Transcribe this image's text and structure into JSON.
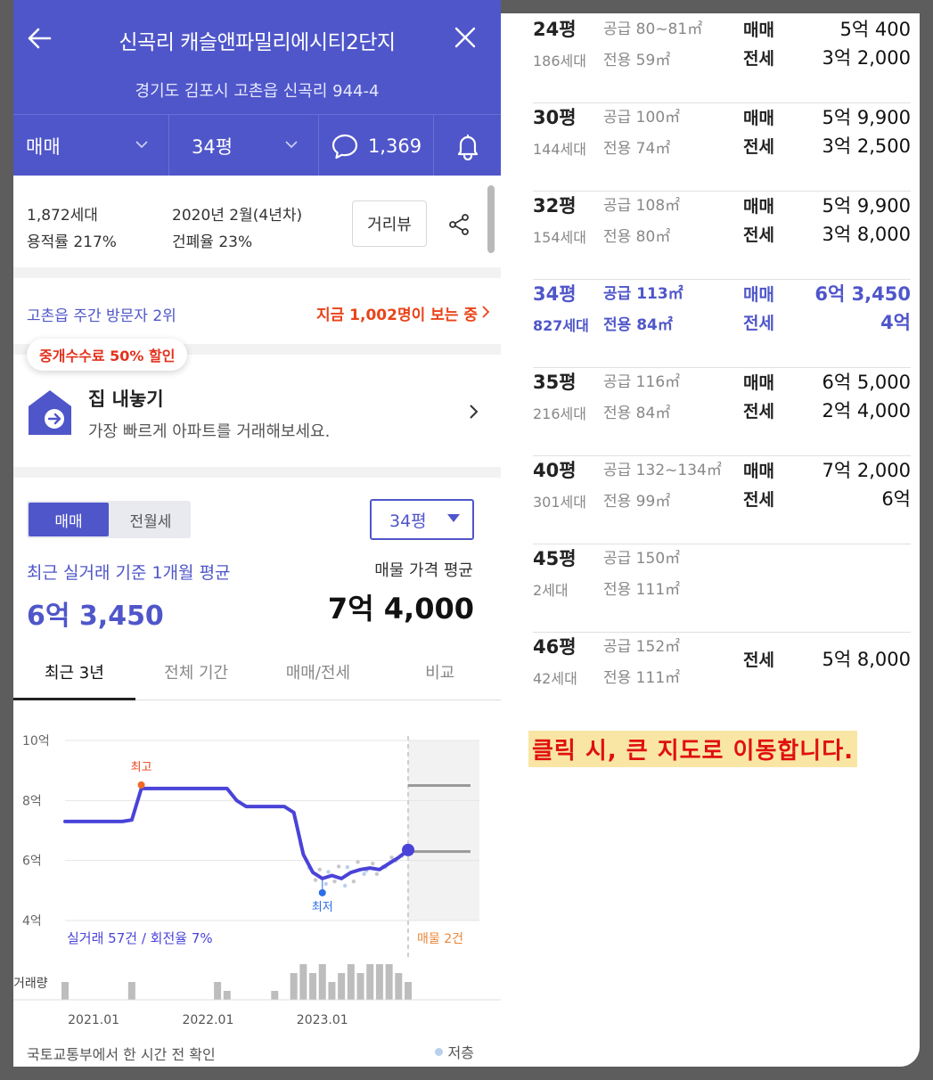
{
  "header": {
    "title": "신곡리 캐슬앤파밀리에시티2단지",
    "address": "경기도 김포시 고촌읍 신곡리 944-4",
    "trade_type": "매매",
    "pyeong": "34평",
    "comment_count": "1,369"
  },
  "info": {
    "households": "1,872세대",
    "far": "용적률 217%",
    "built": "2020년 2월(4년차)",
    "bcr": "건폐율 23%",
    "street_view": "거리뷰"
  },
  "visitors": {
    "rank": "고촌읍 주간 방문자 2위",
    "now": "지금 1,002명이 보는 중"
  },
  "sell": {
    "badge": "중개수수료 50% 할인",
    "title": "집 내놓기",
    "subtitle": "가장 빠르게 아파트를 거래해보세요."
  },
  "price": {
    "toggle_on": "매매",
    "toggle_off": "전월세",
    "pyeong_select": "34평",
    "avg_label": "최근 실거래 기준 1개월 평균",
    "avg_value": "6억 3,450",
    "listing_label": "매물 가격 평균",
    "listing_value": "7억 4,000",
    "tabs": [
      "최근 3년",
      "전체 기간",
      "매매/전세",
      "비교"
    ]
  },
  "chart_data": {
    "type": "line",
    "y_ticks": [
      "10억",
      "8억",
      "6억",
      "4억"
    ],
    "ylim": [
      4,
      10
    ],
    "x_ticks": [
      "2021.01",
      "2022.01",
      "2023.01"
    ],
    "series": [
      {
        "x": [
          "2020-10",
          "2020-11",
          "2020-12",
          "2021-01",
          "2021-02",
          "2021-03",
          "2021-04",
          "2021-05",
          "2021-06",
          "2021-07",
          "2021-08",
          "2021-09",
          "2021-10",
          "2021-11",
          "2021-12",
          "2022-01",
          "2022-02",
          "2022-03",
          "2022-04",
          "2022-05",
          "2022-06",
          "2022-07",
          "2022-08",
          "2022-09",
          "2022-10",
          "2022-11",
          "2022-12",
          "2023-01",
          "2023-02",
          "2023-03",
          "2023-04",
          "2023-05",
          "2023-06",
          "2023-07",
          "2023-08",
          "2023-09",
          "2023-10"
        ],
        "values": [
          7.3,
          7.3,
          7.3,
          7.3,
          7.3,
          7.3,
          7.3,
          7.35,
          8.4,
          8.4,
          8.4,
          8.4,
          8.4,
          8.4,
          8.4,
          8.4,
          8.4,
          8.4,
          8.0,
          7.8,
          7.8,
          7.8,
          7.8,
          7.8,
          7.6,
          6.2,
          5.6,
          5.4,
          5.5,
          5.4,
          5.6,
          5.7,
          5.75,
          5.7,
          5.9,
          6.1,
          6.35
        ]
      }
    ],
    "annotations": {
      "high": "최고",
      "low": "최저"
    },
    "listing_levels": [
      8.5,
      6.3
    ],
    "stat_left": "실거래 57건 / 회전율 7%",
    "stat_right": "매물 2건",
    "volume_label": "거래량",
    "volume": [
      1,
      0,
      0,
      0,
      0,
      0,
      0,
      1,
      0,
      0,
      0,
      0,
      0,
      0,
      0,
      0,
      1,
      0.5,
      0,
      0,
      0,
      0,
      0.5,
      0,
      1.5,
      2,
      1.5,
      2,
      1,
      1.5,
      2,
      1.5,
      2,
      2,
      2,
      1.5,
      1
    ],
    "source": "국토교통부에서 한 시간 전 확인",
    "legend": "저층"
  },
  "rows": [
    {
      "pyeong": "24평",
      "hh": "186세대",
      "supply": "공급 80~81㎡",
      "excl": "전용 59㎡",
      "l1": "매매",
      "v1": "5억 400",
      "l2": "전세",
      "v2": "3억 2,000"
    },
    {
      "pyeong": "30평",
      "hh": "144세대",
      "supply": "공급 100㎡",
      "excl": "전용 74㎡",
      "l1": "매매",
      "v1": "5억 9,900",
      "l2": "전세",
      "v2": "3억 2,500"
    },
    {
      "pyeong": "32평",
      "hh": "154세대",
      "supply": "공급 108㎡",
      "excl": "전용 80㎡",
      "l1": "매매",
      "v1": "5억 9,900",
      "l2": "전세",
      "v2": "3억 8,000"
    },
    {
      "pyeong": "34평",
      "hh": "827세대",
      "supply": "공급 113㎡",
      "excl": "전용 84㎡",
      "l1": "매매",
      "v1": "6억 3,450",
      "l2": "전세",
      "v2": "4억",
      "selected": true
    },
    {
      "pyeong": "35평",
      "hh": "216세대",
      "supply": "공급 116㎡",
      "excl": "전용 84㎡",
      "l1": "매매",
      "v1": "6억 5,000",
      "l2": "전세",
      "v2": "2억 4,000"
    },
    {
      "pyeong": "40평",
      "hh": "301세대",
      "supply": "공급 132~134㎡",
      "excl": "전용 99㎡",
      "l1": "매매",
      "v1": "7억 2,000",
      "l2": "전세",
      "v2": "6억"
    },
    {
      "pyeong": "45평",
      "hh": "2세대",
      "supply": "공급 150㎡",
      "excl": "전용 111㎡",
      "l1": "",
      "v1": "",
      "l2": "",
      "v2": ""
    },
    {
      "pyeong": "46평",
      "hh": "42세대",
      "supply": "공급 152㎡",
      "excl": "전용 111㎡",
      "l1": "",
      "v1": "",
      "l2": "전세",
      "v2": "5억 8,000"
    }
  ],
  "notice": "클릭 시, 큰 지도로 이동합니다.",
  "colors": {
    "brand": "#4f56c9",
    "accent_red": "#e9431a",
    "notice_bg": "#f9e6a5"
  }
}
